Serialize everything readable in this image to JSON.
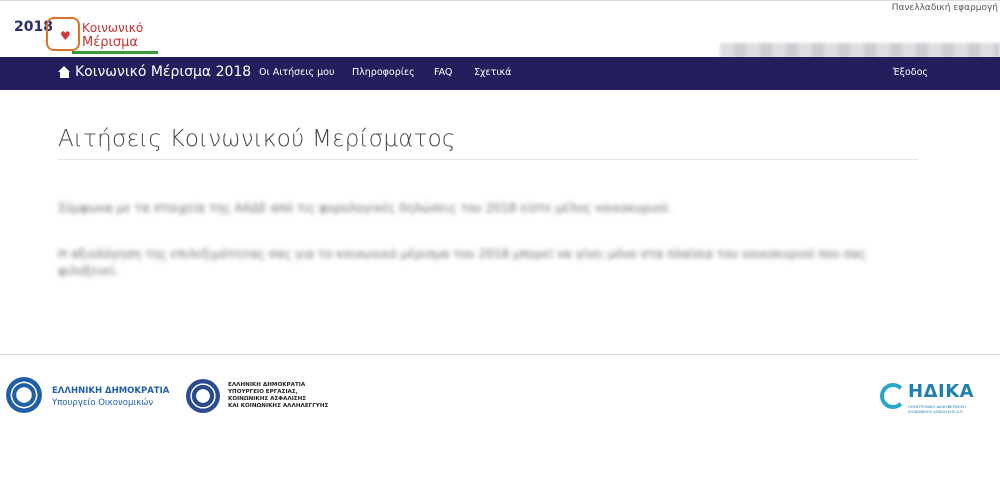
{
  "header": {
    "logo": {
      "year": "2018",
      "line1": "Κοινωνικό",
      "line2": "Μέρισμα"
    },
    "region_link": "Πανελλαδική εφαρμογή"
  },
  "navbar": {
    "brand": "Κοινωνικό Μέρισμα 2018",
    "items": [
      {
        "label": "Οι Αιτήσεις μου"
      },
      {
        "label": "Πληροφορίες"
      },
      {
        "label": "FAQ"
      },
      {
        "label": "Σχετικά"
      }
    ],
    "logout": "Έξοδος"
  },
  "main": {
    "title": "Αιτήσεις Κοινωνικού Μερίσματος",
    "paragraph1": "Σύμφωνα με τα στοιχεία της ΑΑΔΕ από τις φορολογικές δηλώσεις του 2018 είστε μέλος νοικοκυριού.",
    "paragraph2": "Η αξιολόγηση της επιλεξιμότητας σας για το κοινωνικό μέρισμα του 2018 μπορεί να γίνει μόνο στα πλαίσια του νοικοκυριού που σας φιλοξενεί."
  },
  "footer": {
    "ministry1_line1": "ΕΛΛΗΝΙΚΗ ΔΗΜΟΚΡΑΤΙΑ",
    "ministry1_line2": "Υπουργείο Οικονομικών",
    "ministry2_lines": "ΕΛΛΗΝΙΚΗ ΔΗΜΟΚΡΑΤΙΑ\nΥΠΟΥΡΓΕΙΟ ΕΡΓΑΣΙΑΣ,\nΚΟΙΝΩΝΙΚΗΣ ΑΣΦΑΛΙΣΗΣ\nΚΑΙ ΚΟΙΝΩΝΙΚΗΣ ΑΛΛΗΛΕΓΓΥΗΣ",
    "idika_name": "ΗΔΙΚΑ",
    "idika_sub": "ΗΛΕΚΤΡΟΝΙΚΗ ΔΙΑΚΥΒΕΡΝΗΣΗ ΚΟΙΝΩΝΙΚΗΣ ΑΣΦΑΛΙΣΗΣ Α.Ε."
  }
}
